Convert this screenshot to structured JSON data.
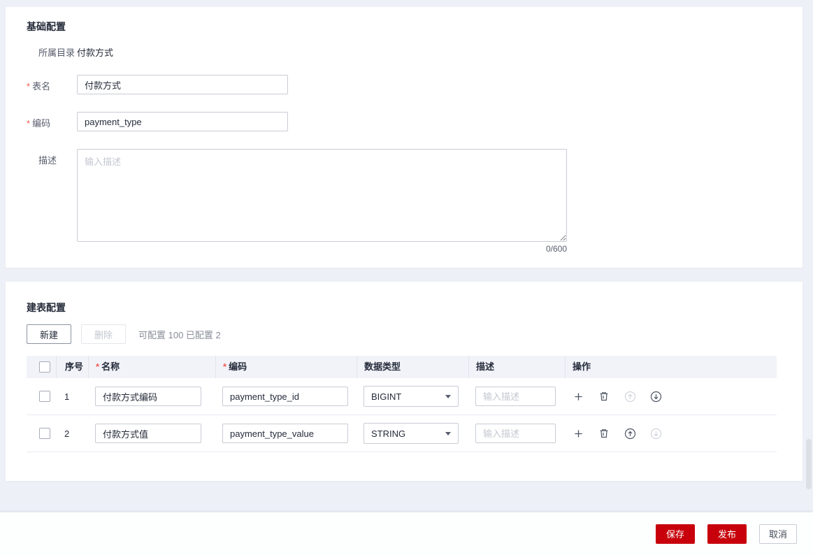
{
  "colors": {
    "accent_red": "#c7000b",
    "page_bg": "#eef0f7",
    "required": "#f45c52",
    "header_bg": "#f1f3f9"
  },
  "basic": {
    "title": "基础配置",
    "required_mark": "*",
    "fields": {
      "catalog": {
        "label": "所属目录",
        "value": "付款方式"
      },
      "table_name": {
        "label": "表名",
        "value": "付款方式"
      },
      "code": {
        "label": "编码",
        "value": "payment_type"
      },
      "description": {
        "label": "描述",
        "placeholder": "输入描述",
        "counter": "0/600"
      }
    }
  },
  "table_config": {
    "title": "建表配置",
    "toolbar": {
      "new_button": "新建",
      "delete_button": "删除",
      "quota_text": "可配置 100 已配置 2"
    },
    "columns": {
      "no": "序号",
      "name": "名称",
      "code": "编码",
      "type": "数据类型",
      "desc": "描述",
      "ops": "操作"
    },
    "rows": [
      {
        "no": "1",
        "name": "付款方式编码",
        "code": "payment_type_id",
        "type": "BIGINT",
        "desc_placeholder": "输入描述"
      },
      {
        "no": "2",
        "name": "付款方式值",
        "code": "payment_type_value",
        "type": "STRING",
        "desc_placeholder": "输入描述"
      }
    ]
  },
  "footer": {
    "save": "保存",
    "publish": "发布",
    "cancel": "取消"
  }
}
